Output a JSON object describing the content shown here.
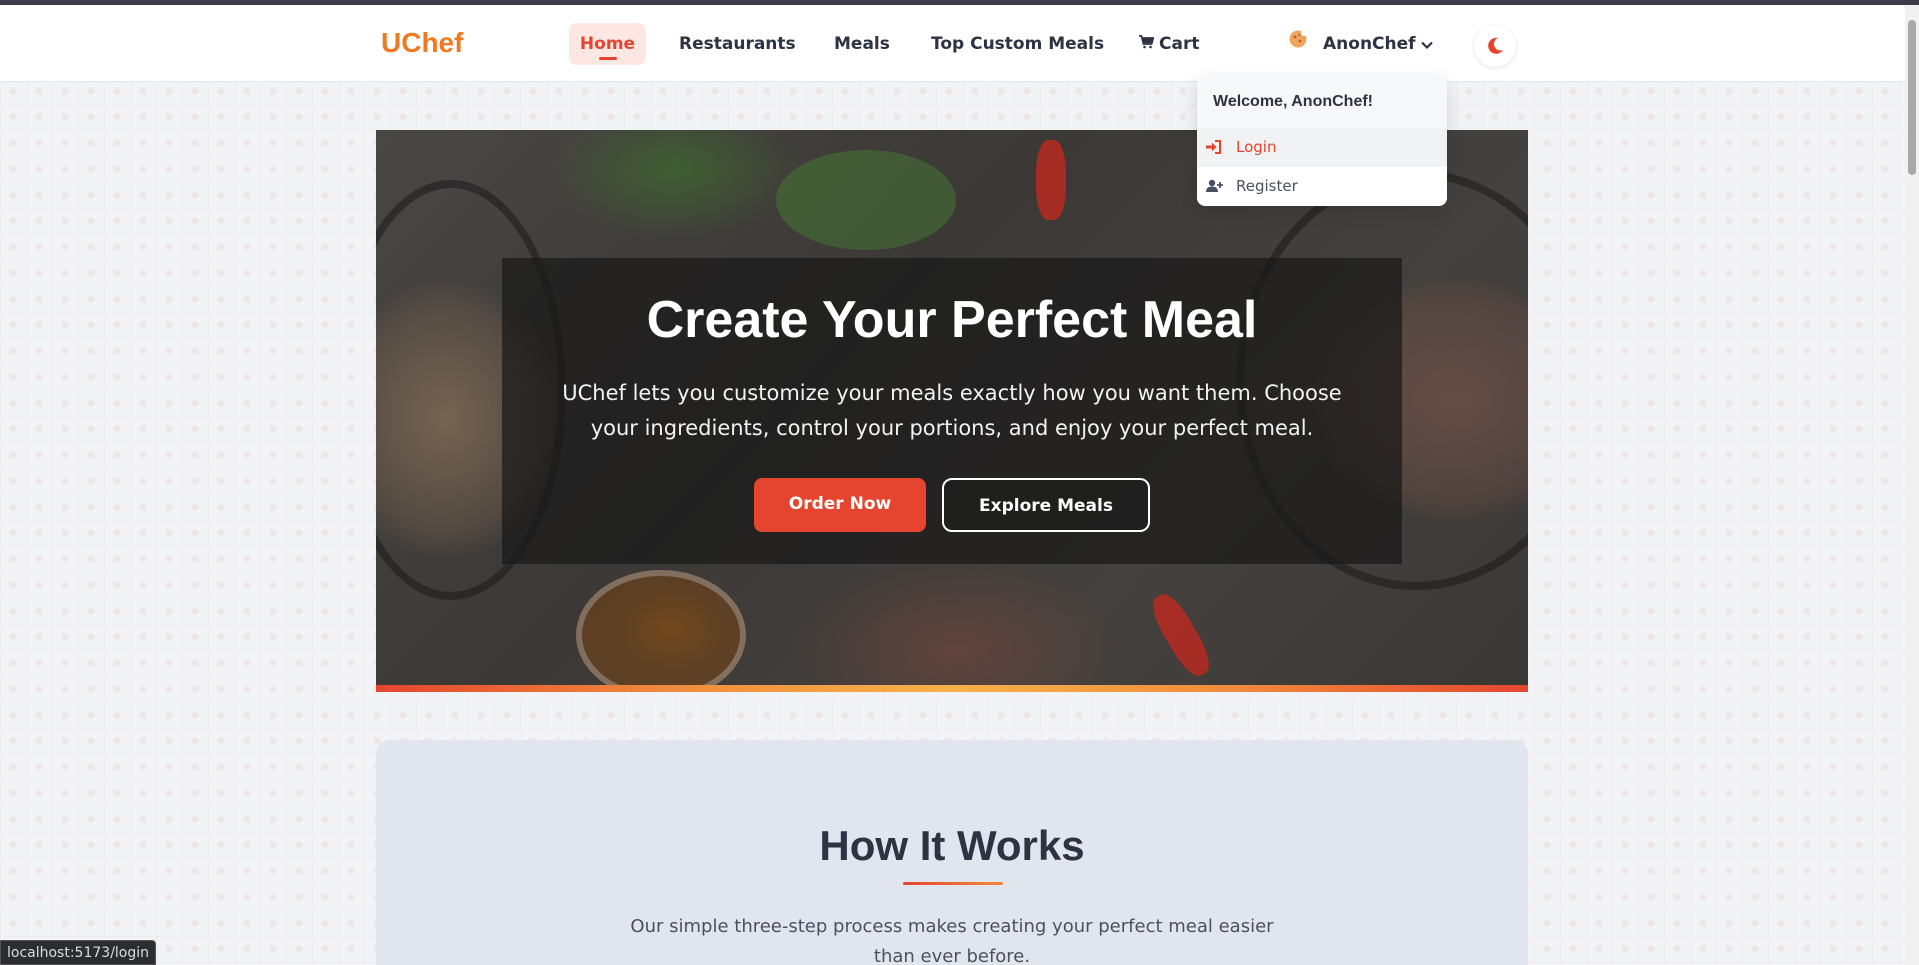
{
  "navbar": {
    "logo": "UChef",
    "links": [
      "Home",
      "Restaurants",
      "Meals",
      "Top Custom Meals"
    ],
    "cart_label": "Cart",
    "user_name": "AnonChef",
    "active": "Home"
  },
  "dropdown": {
    "welcome": "Welcome, AnonChef!",
    "items": [
      "Login",
      "Register"
    ]
  },
  "hero": {
    "title": "Create Your Perfect Meal",
    "text": "UChef lets you customize your meals exactly how you want them. Choose your ingredients, control your portions, and enjoy your perfect meal.",
    "primary_button": "Order Now",
    "secondary_button": "Explore Meals"
  },
  "how": {
    "title": "How It Works",
    "subtitle": "Our simple three-step process makes creating your perfect meal easier than ever before."
  },
  "status_url": "localhost:5173/login",
  "colors": {
    "accent": "#e5452f",
    "brand": "#ef7a22",
    "dark": "#2d3342"
  },
  "icons": {
    "cart": "cart-icon",
    "user": "cookie-avatar-icon",
    "chevron": "chevron-down-icon",
    "theme": "moon-icon",
    "login": "sign-in-icon",
    "register": "user-plus-icon"
  }
}
